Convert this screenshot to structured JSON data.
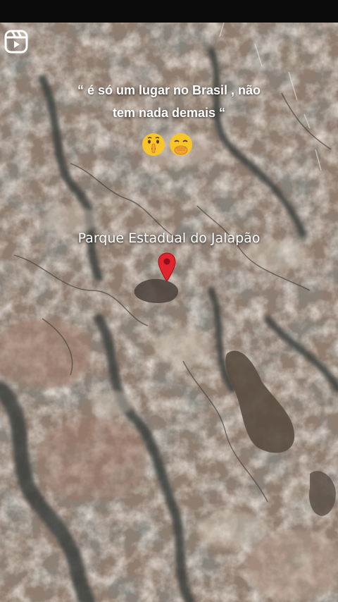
{
  "app": {
    "icon": "reels-icon"
  },
  "caption": {
    "line1": "“ é só um lugar no Brasil , não",
    "line2": "tem nada demais “"
  },
  "emojis": [
    {
      "name": "shushing-face-icon"
    },
    {
      "name": "face-with-hand-over-mouth-icon"
    }
  ],
  "map": {
    "place_label": "Parque Estadual do Jalapão",
    "marker": "map-pin-icon",
    "marker_color": "#e0252e"
  },
  "colors": {
    "terrain_base": "#8f7d70",
    "terrain_dark": "#3f413e",
    "terrain_light": "#c9bcae",
    "top_bar": "#0a0a0a"
  }
}
